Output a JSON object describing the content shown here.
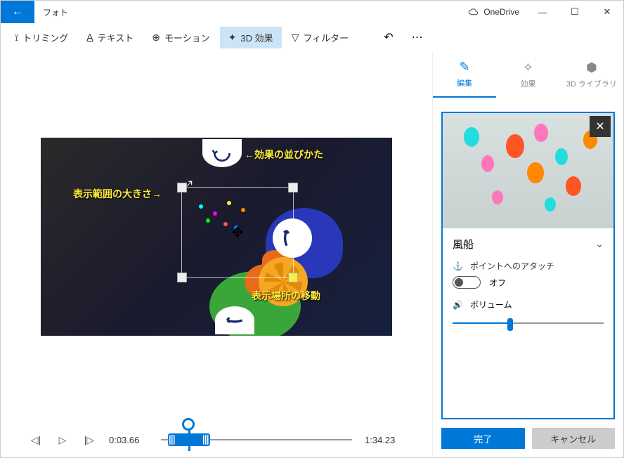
{
  "titlebar": {
    "app_title": "フォト",
    "onedrive": "OneDrive"
  },
  "toolbar": {
    "trim": "トリミング",
    "text": "テキスト",
    "motion": "モーション",
    "effects3d": "3D 効果",
    "filter": "フィルター"
  },
  "annotations": {
    "ordering": "←効果の並びかた",
    "size": "表示範囲の大きさ→",
    "move": "表示場所の移動"
  },
  "timeline": {
    "current": "0:03.66",
    "total": "1:34.23"
  },
  "right_tabs": {
    "edit": "編集",
    "effects": "効果",
    "library3d": "3D ライブラリ"
  },
  "panel": {
    "title": "風船",
    "attach_label": "ポイントへのアタッチ",
    "toggle_state": "オフ",
    "volume_label": "ボリューム"
  },
  "footer": {
    "done": "完了",
    "cancel": "キャンセル"
  }
}
